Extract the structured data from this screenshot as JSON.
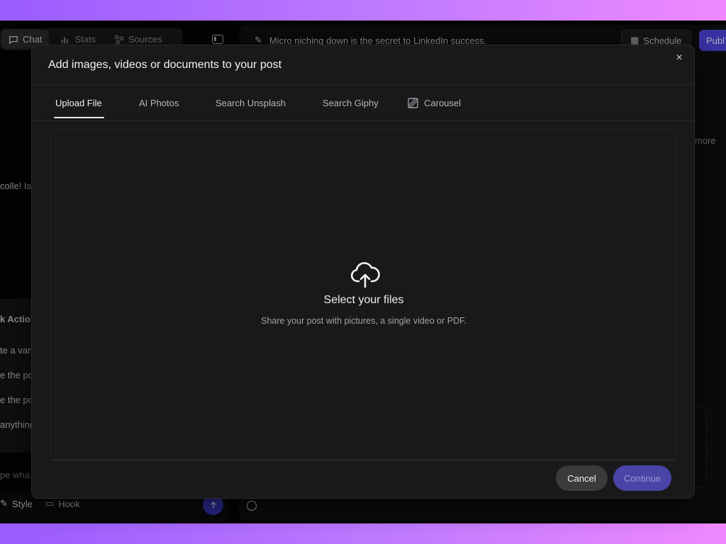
{
  "background": {
    "nav_tabs": [
      {
        "label": "Chat",
        "icon": "chat-icon",
        "active": true
      },
      {
        "label": "Stats",
        "icon": "bar-chart-icon",
        "active": false
      },
      {
        "label": "Sources",
        "icon": "sources-icon",
        "active": false
      }
    ],
    "left_fragments": {
      "message": "colle! Is",
      "quick_actions": "k Actio",
      "action_1": "te a vari",
      "action_2": "e the po",
      "action_3": "e the po",
      "action_4": "anything",
      "input_placeholder": "pe wha",
      "style_label": "Style",
      "hook_label": "Hook"
    },
    "post_title": "Micro niching down is the secret to LinkedIn success.",
    "schedule_label": "Schedule",
    "publish_label": "Publ",
    "more_label": "more"
  },
  "modal": {
    "title": "Add images, videos or documents to your post",
    "close_icon": "×",
    "tabs": [
      {
        "label": "Upload File",
        "active": true
      },
      {
        "label": "AI Photos",
        "active": false
      },
      {
        "label": "Search Unsplash",
        "active": false
      },
      {
        "label": "Search Giphy",
        "active": false
      },
      {
        "label": "Carousel",
        "active": false,
        "icon": "carousel-icon"
      }
    ],
    "dropzone": {
      "icon": "cloud-upload-icon",
      "title": "Select your files",
      "subtitle": "Share your post with pictures, a single video or PDF."
    },
    "cancel_label": "Cancel",
    "continue_label": "Continue"
  },
  "colors": {
    "accent": "#4b43d8",
    "gradient_start": "#9b5cff",
    "gradient_end": "#f089ff"
  }
}
